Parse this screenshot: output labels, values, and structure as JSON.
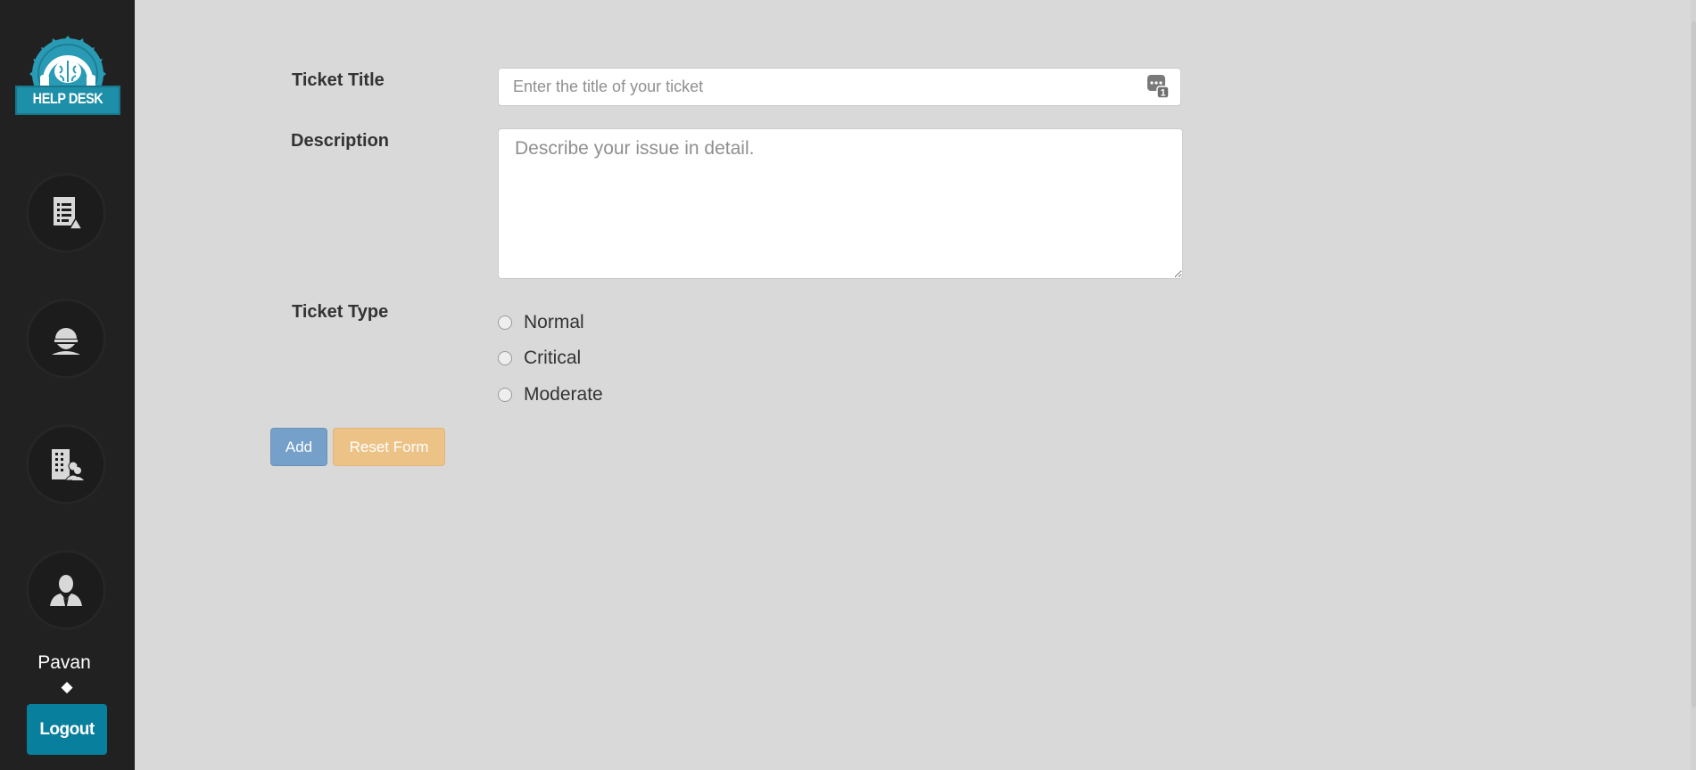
{
  "brand": {
    "logo_text": "HELP DESK"
  },
  "sidebar": {
    "nav": [
      {
        "icon": "ticket-list-icon"
      },
      {
        "icon": "user-icon"
      },
      {
        "icon": "building-users-icon"
      },
      {
        "icon": "admin-user-icon"
      }
    ],
    "user_name": "Pavan",
    "user_caret": "◆",
    "logout_label": "Logout"
  },
  "form": {
    "title_label": "Ticket Title",
    "title_placeholder": "Enter the title of your ticket",
    "title_value": "",
    "badge_icon": "password-manager-icon",
    "badge_count": "1",
    "description_label": "Description",
    "description_placeholder": "Describe your issue in detail.",
    "description_value": "",
    "type_label": "Ticket Type",
    "type_options": [
      "Normal",
      "Critical",
      "Moderate"
    ],
    "type_selected": null
  },
  "actions": {
    "add_label": "Add",
    "reset_label": "Reset Form"
  },
  "colors": {
    "sidebar_bg": "#212121",
    "page_bg": "#d9d9d9",
    "logout": "#087f9c",
    "add": "#75a0c9",
    "reset": "#ecc287",
    "logo_accent": "#2a9bb4"
  }
}
